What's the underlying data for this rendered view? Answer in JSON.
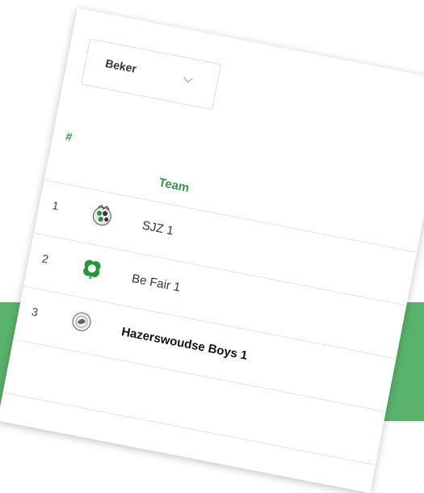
{
  "colors": {
    "accent": "#59b36c",
    "header_text": "#2e9a4a"
  },
  "dropdown": {
    "selected": "Beker",
    "icon": "chevron-down-icon"
  },
  "table": {
    "headers": {
      "rank": "#",
      "team": "Team"
    },
    "rows": [
      {
        "rank": "1",
        "team": "SJZ 1",
        "logo": "sjz-club-logo",
        "bold": false
      },
      {
        "rank": "2",
        "team": "Be Fair 1",
        "logo": "be-fair-club-logo",
        "bold": false
      },
      {
        "rank": "3",
        "team": "Hazerswoudse Boys 1",
        "logo": "hazerswoudse-boys-club-logo",
        "bold": true
      }
    ]
  }
}
